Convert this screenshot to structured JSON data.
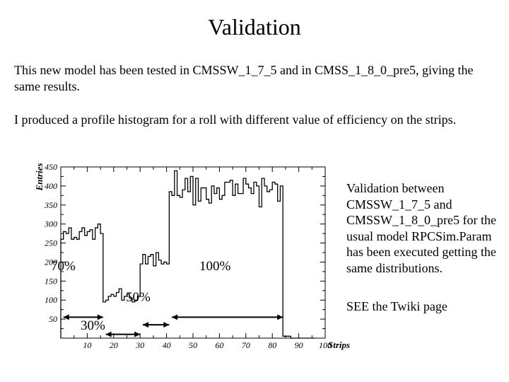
{
  "title": "Validation",
  "para1": "This new model has been tested in CMSSW_1_7_5 and in CMSS_1_8_0_pre5, giving the same results.",
  "para2": "I produced a profile histogram for a roll with different value of efficiency on the strips.",
  "caption1": "Validation between CMSSW_1_7_5 and CMSSW_1_8_0_pre5 for the usual model RPCSim.Param has been executed getting the same distributions.",
  "caption2": "SEE the Twiki page",
  "annotations": {
    "a70": "70%",
    "a30": "30%",
    "a50": "50%",
    "a100": "100%"
  },
  "chart_data": {
    "type": "bar",
    "title": "",
    "xlabel": "Strips",
    "ylabel": "Entries",
    "xlim": [
      0,
      100
    ],
    "ylim": [
      0,
      450
    ],
    "xticks": [
      10,
      20,
      30,
      40,
      50,
      60,
      70,
      80,
      90,
      100
    ],
    "yticks": [
      50,
      100,
      150,
      200,
      250,
      300,
      350,
      400,
      450
    ],
    "categories": [
      1,
      2,
      3,
      4,
      5,
      6,
      7,
      8,
      9,
      10,
      11,
      12,
      13,
      14,
      15,
      16,
      17,
      18,
      19,
      20,
      21,
      22,
      23,
      24,
      25,
      26,
      27,
      28,
      29,
      30,
      31,
      32,
      33,
      34,
      35,
      36,
      37,
      38,
      39,
      40,
      41,
      42,
      43,
      44,
      45,
      46,
      47,
      48,
      49,
      50,
      51,
      52,
      53,
      54,
      55,
      56,
      57,
      58,
      59,
      60,
      61,
      62,
      63,
      64,
      65,
      66,
      67,
      68,
      69,
      70,
      71,
      72,
      73,
      74,
      75,
      76,
      77,
      78,
      79,
      80,
      81,
      82,
      83,
      84,
      85,
      86,
      87,
      88,
      89,
      90,
      91,
      92,
      93,
      94,
      95,
      96
    ],
    "values": [
      260,
      280,
      275,
      290,
      260,
      265,
      260,
      280,
      290,
      270,
      280,
      285,
      260,
      290,
      300,
      275,
      95,
      100,
      110,
      115,
      110,
      120,
      130,
      100,
      110,
      115,
      105,
      95,
      100,
      110,
      195,
      220,
      195,
      215,
      220,
      190,
      225,
      205,
      195,
      200,
      195,
      385,
      375,
      440,
      375,
      370,
      390,
      420,
      385,
      425,
      350,
      420,
      360,
      395,
      395,
      365,
      355,
      400,
      380,
      395,
      365,
      375,
      410,
      410,
      415,
      375,
      405,
      380,
      380,
      420,
      405,
      395,
      380,
      410,
      400,
      345,
      420,
      400,
      385,
      390,
      410,
      405,
      360,
      400,
      5,
      5,
      5,
      0,
      0,
      0,
      0,
      0,
      0,
      0,
      0,
      0
    ]
  }
}
